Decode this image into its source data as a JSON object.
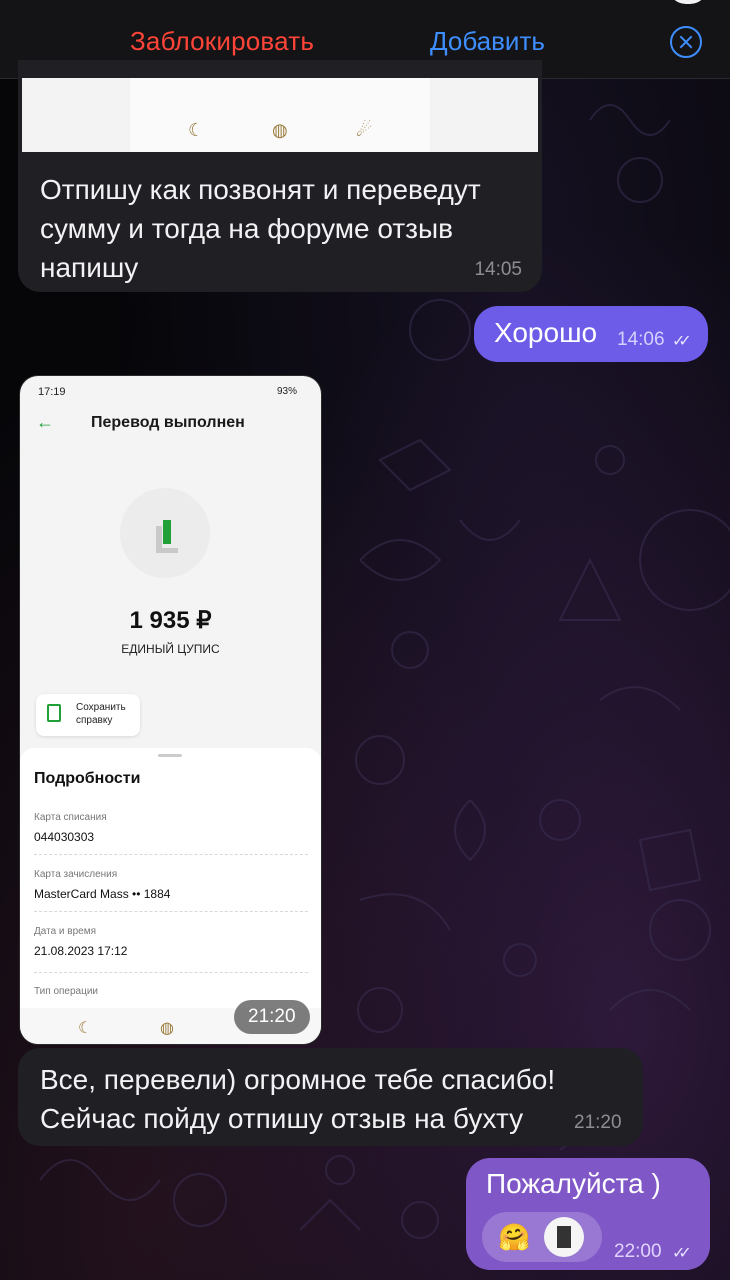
{
  "topbar": {
    "block_label": "Заблокировать",
    "add_label": "Добавить",
    "close_icon": "close-circle-icon",
    "colors": {
      "block": "#ff4438",
      "add": "#3e8eff",
      "background": "#141416"
    }
  },
  "messages": {
    "m1": {
      "text": "Отпишу как позвонят и переведут\nсумму и тогда на форуме отзыв\nнапишу",
      "time": "14:05"
    },
    "m2": {
      "text": "Хорошо",
      "time": "14:06",
      "status": "read"
    },
    "m3": {
      "time": "21:20",
      "screenshot": {
        "status_time": "17:19",
        "status_right": "93%",
        "title": "Перевод выполнен",
        "amount": "1 935 ₽",
        "recipient": "ЕДИНЫЙ ЦУПИС",
        "save_label": "Сохранить\nсправку",
        "details_title": "Подробности",
        "rows": [
          {
            "label": "Карта списания",
            "value": "044030303"
          },
          {
            "label": "Карта зачисления",
            "value": "MasterCard Mass •• 1884"
          },
          {
            "label": "Дата и время",
            "value": "21.08.2023 17:12"
          },
          {
            "label": "Тип операции",
            "value": ""
          }
        ]
      }
    },
    "m4": {
      "text": "Все, перевели) огромное тебе спасибо!\nСейчас пойду отпишу отзыв на бухту",
      "time": "21:20"
    },
    "m5": {
      "text": "Пожалуйста )",
      "time": "22:00",
      "status": "read",
      "reaction_emoji": "🤗"
    }
  },
  "colors": {
    "incoming_bubble": "#1f1f24",
    "outgoing_bubble": "#6d5ce8",
    "outgoing_bubble_alt": "#7f57c7"
  }
}
